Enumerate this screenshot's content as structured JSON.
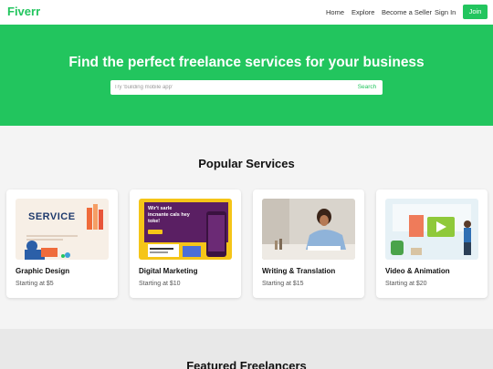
{
  "nav": {
    "logo": "Fiverr",
    "links": [
      "Home",
      "Explore",
      "Become a Seller",
      "Sign In"
    ],
    "join": "Join"
  },
  "hero": {
    "title": "Find the perfect freelance services for your business",
    "search_placeholder": "Try 'building mobile app'",
    "search_button": "Search"
  },
  "popular": {
    "title": "Popular Services",
    "cards": [
      {
        "title": "Graphic Design",
        "price": "Starting at $5",
        "image_text": "SERVICE"
      },
      {
        "title": "Digital Marketing",
        "price": "Starting at $10",
        "image_text": "Wir't sarle incnante cals hey toke!"
      },
      {
        "title": "Writing & Translation",
        "price": "Starting at $15"
      },
      {
        "title": "Video & Animation",
        "price": "Starting at $20"
      }
    ]
  },
  "featured": {
    "title": "Featured Freelancers"
  },
  "colors": {
    "brand": "#22c55e"
  }
}
